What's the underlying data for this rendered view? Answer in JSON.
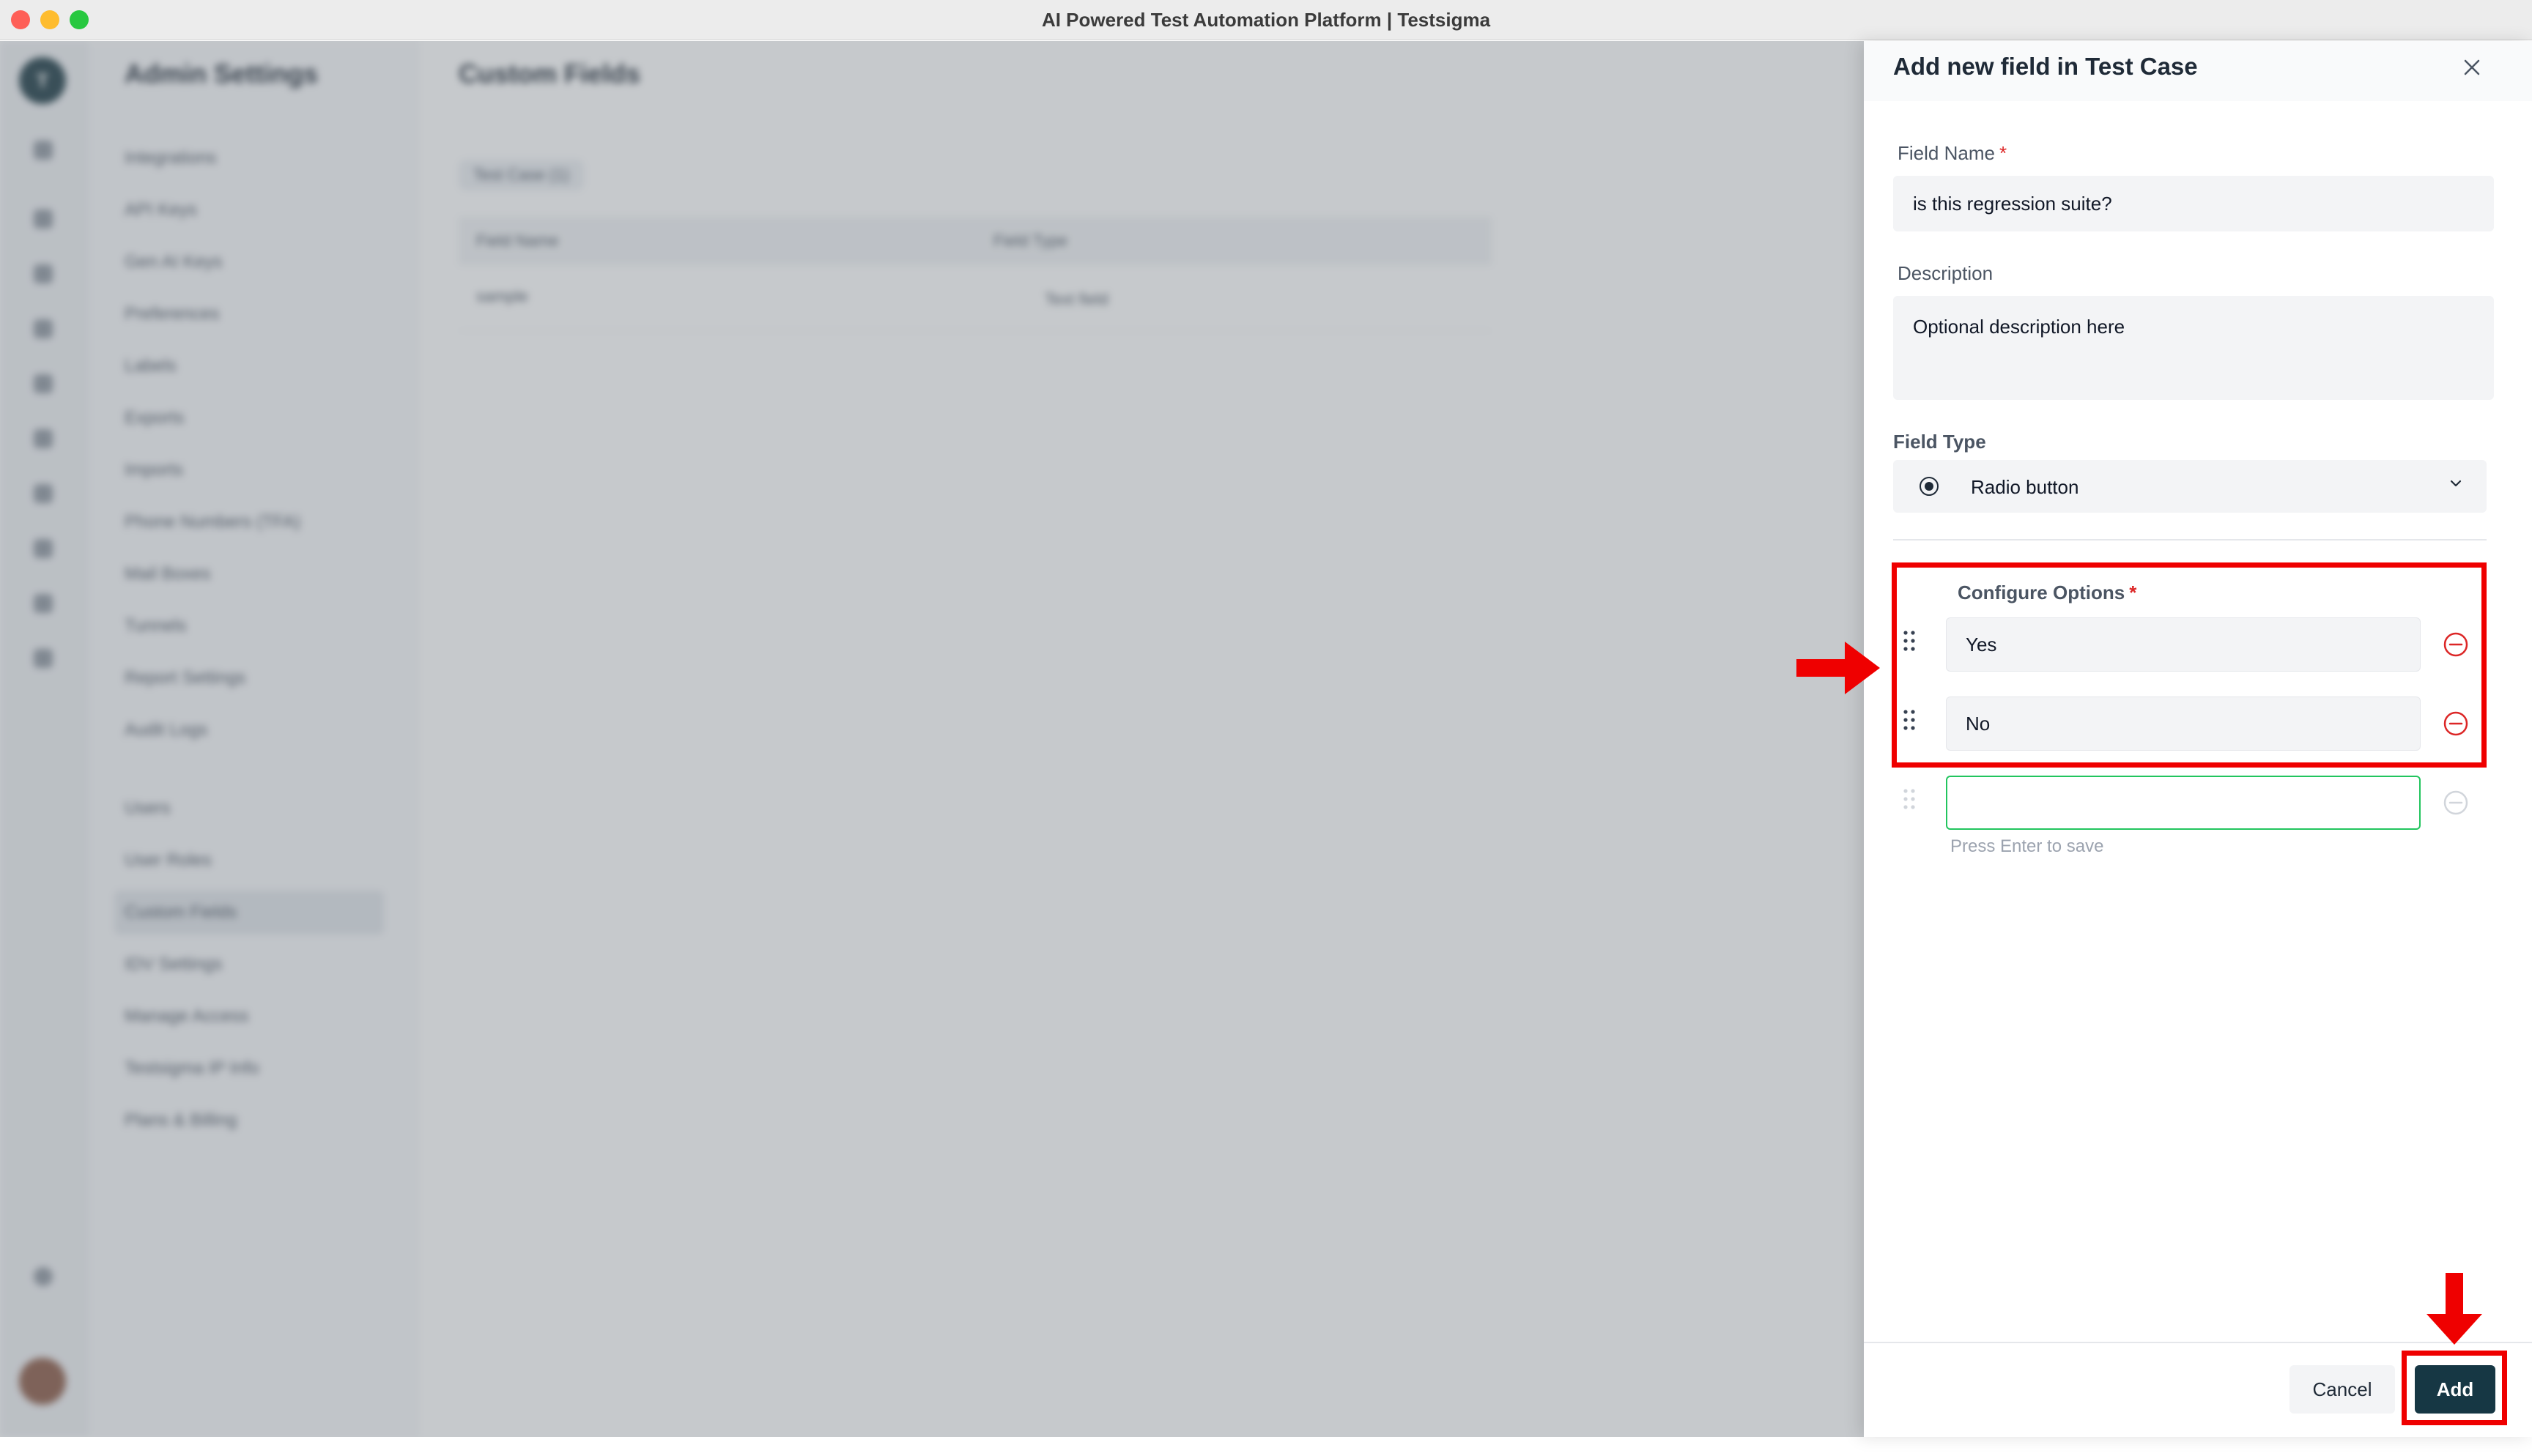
{
  "window": {
    "title": "AI Powered Test Automation Platform | Testsigma"
  },
  "background_app": {
    "rail_logo": "T",
    "admin_title": "Admin Settings",
    "nav_items": [
      "Integrations",
      "API Keys",
      "Gen AI Keys",
      "Preferences",
      "Labels",
      "Exports",
      "Imports",
      "Phone Numbers (TFA)",
      "Mail Boxes",
      "Tunnels",
      "Report Settings",
      "Audit Logs"
    ],
    "nav_items_2": [
      "Users",
      "User Roles",
      "Custom Fields",
      "IDV Settings",
      "Manage Access",
      "Testsigma IP Info",
      "Plans & Billing"
    ],
    "page_title": "Custom Fields",
    "tab": "Test Case (1)",
    "table": {
      "headers": [
        "Field Name",
        "Field Type"
      ],
      "row": {
        "name": "sample",
        "type": "Text field"
      }
    }
  },
  "drawer": {
    "title": "Add new field in Test Case",
    "field_name": {
      "label": "Field Name",
      "required_mark": "*",
      "value": "is this regression suite?"
    },
    "description": {
      "label": "Description",
      "placeholder": "Optional description here"
    },
    "field_type": {
      "label": "Field Type",
      "value": "Radio button"
    },
    "options": {
      "label": "Configure Options",
      "required_mark": "*",
      "items": [
        "Yes",
        "No"
      ],
      "new_value": "",
      "hint": "Press Enter to save"
    },
    "footer": {
      "cancel": "Cancel",
      "add": "Add"
    }
  },
  "colors": {
    "annotation": "#ef0000",
    "primary_button": "#163744",
    "danger": "#dc2626",
    "focus_border": "#22c55e"
  }
}
